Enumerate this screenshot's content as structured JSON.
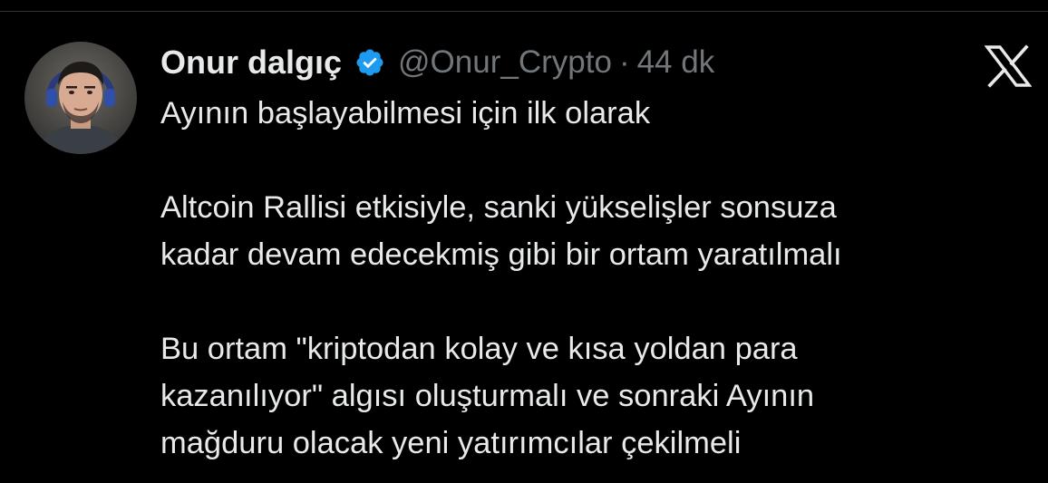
{
  "tweet": {
    "author": {
      "display_name": "Onur dalgıç",
      "handle": "@Onur_Crypto",
      "verified": true,
      "avatar_icon": "user-avatar"
    },
    "separator": "·",
    "time": "44 dk",
    "platform_icon": "x-logo-icon",
    "paragraphs": [
      [
        "Ayının başlayabilmesi için ilk olarak"
      ],
      [
        "Altcoin Rallisi etkisiyle, sanki yükselişler sonsuza",
        "kadar devam edecekmiş gibi bir ortam yaratılmalı"
      ],
      [
        "Bu ortam \"kriptodan kolay ve kısa yoldan para",
        "kazanılıyor\" algısı oluşturmalı ve sonraki Ayının",
        "mağduru olacak yeni yatırımcılar çekilmeli"
      ]
    ]
  },
  "colors": {
    "background": "#000000",
    "text_primary": "#e7e9ea",
    "text_secondary": "#71767b",
    "verified_badge": "#1d9bf0",
    "divider": "#2f3336"
  }
}
